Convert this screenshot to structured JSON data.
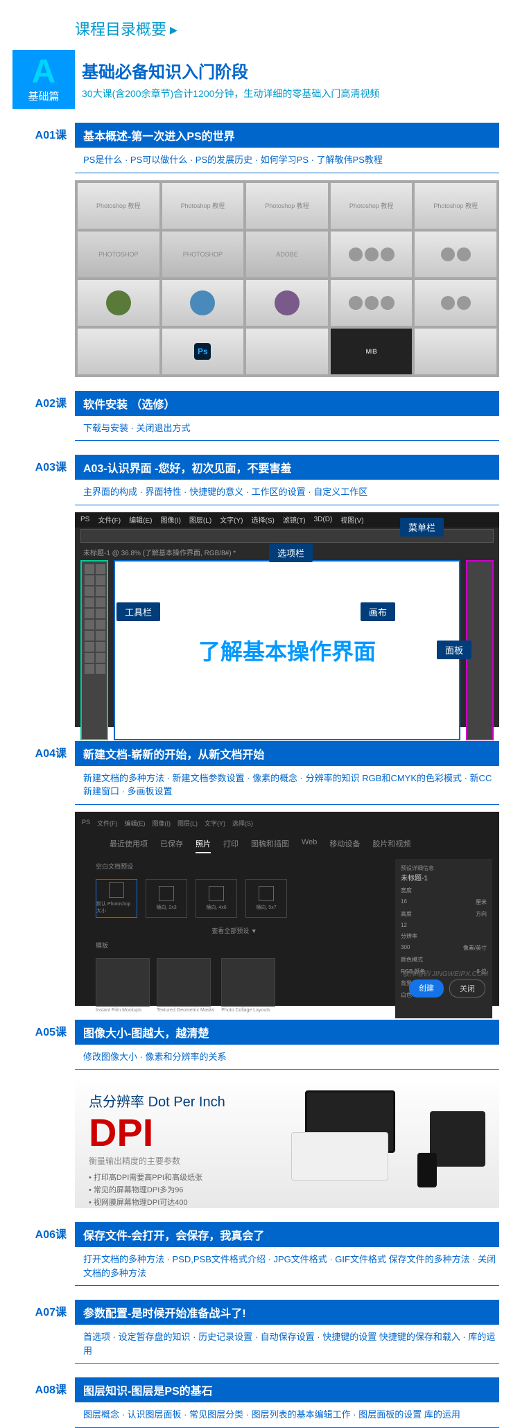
{
  "header": {
    "title": "课程目录概要"
  },
  "section": {
    "badge_letter": "A",
    "badge_text": "基础篇",
    "title": "基础必备知识入门阶段",
    "desc": "30大课(含200余章节)合计1200分钟，生动详细的零基础入门高清视频"
  },
  "lessons": {
    "a01": {
      "label": "A01课",
      "title": "基本概述-第一次进入PS的世界",
      "detail": "PS是什么 · PS可以做什么 · PS的发展历史 · 如何学习PS · 了解敬伟PS教程"
    },
    "a02": {
      "label": "A02课",
      "title": "软件安装 （选修）",
      "detail": "下载与安装 · 关闭退出方式"
    },
    "a03": {
      "label": "A03课",
      "title": "A03-认识界面 -您好，初次见面，不要害羞",
      "detail": "主界面的构成 · 界面特性 · 快捷键的意义 · 工作区的设置 · 自定义工作区"
    },
    "a04": {
      "label": "A04课",
      "title": "新建文档-崭新的开始，从新文档开始",
      "detail": "新建文档的多种方法 · 新建文档参数设置 · 像素的概念 · 分辨率的知识\nRGB和CMYK的色彩模式 · 新CC新建窗口 · 多画板设置"
    },
    "a05": {
      "label": "A05课",
      "title": "图像大小-图越大，越清楚",
      "detail": "修改图像大小 · 像素和分辨率的关系"
    },
    "a06": {
      "label": "A06课",
      "title": "保存文件-会打开，会保存，我真会了",
      "detail": "打开文档的多种方法 · PSD,PSB文件格式介绍 · JPG文件格式 · GIF文件格式\n保存文件的多种方法 · 关闭文档的多种方法"
    },
    "a07": {
      "label": "A07课",
      "title": "参数配置-是时候开始准备战斗了!",
      "detail": "首选项 · 设定暂存盘的知识 · 历史记录设置 · 自动保存设置 · 快捷键的设置\n快捷键的保存和载入 · 库的运用"
    },
    "a08": {
      "label": "A08课",
      "title": "图层知识-图层是PS的基石",
      "detail": "图层概念 · 认识图层面板 · 常见图层分类 · 图层列表的基本编辑工作 · 图层面板的设置\n库的运用"
    }
  },
  "ps_interface": {
    "canvas_text": "了解基本操作界面",
    "labels": {
      "menu": "菜单栏",
      "options": "选项栏",
      "tools": "工具栏",
      "canvas": "画布",
      "panel": "面板"
    },
    "tab_text": "未标题-1 @ 36.8% (了解基本操作界面, RGB/8#) *"
  },
  "new_doc": {
    "tabs": [
      "最近使用项",
      "已保存",
      "照片",
      "打印",
      "图稿和插图",
      "Web",
      "移动设备",
      "胶片和视频"
    ],
    "active_tab": "照片",
    "side_title": "未标题-1",
    "presets": [
      "默认 Photoshop 大小",
      "横向, 2x3",
      "横向, 4x6",
      "横向, 5x7"
    ],
    "templates": [
      "Instant Film Mockups",
      "Textured Geometric Masks",
      "Photo Collage Layouts"
    ],
    "btn_create": "创建",
    "btn_close": "关闭",
    "watermark": "敬伟培训 JINGWEIPX.COM"
  },
  "dpi": {
    "title_cn": "点分辨率",
    "title_en": "Dot Per Inch",
    "big": "DPI",
    "sub": "衡量输出精度的主要参数",
    "items": [
      "打印高DPI需要高PPI和高级纸张",
      "常见的屏幕物理DPI多为96",
      "视网膜屏幕物理DPI可达400"
    ]
  }
}
